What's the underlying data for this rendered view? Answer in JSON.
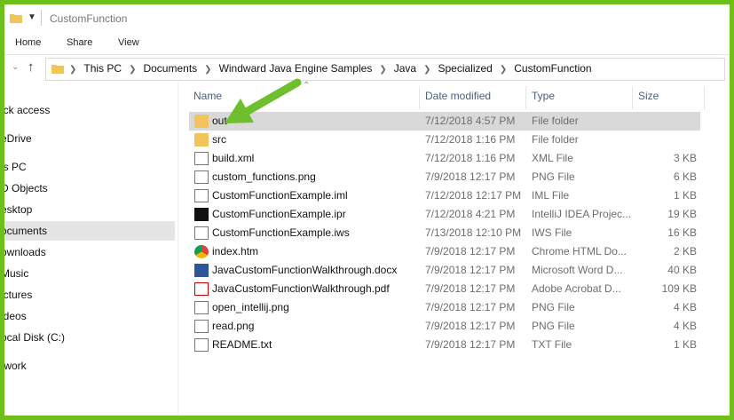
{
  "window": {
    "title": "CustomFunction"
  },
  "ribbon": {
    "tabs": [
      "Home",
      "Share",
      "View"
    ]
  },
  "address": {
    "crumbs": [
      "This PC",
      "Documents",
      "Windward Java Engine Samples",
      "Java",
      "Specialized",
      "CustomFunction"
    ]
  },
  "nav": {
    "items": [
      {
        "label": "ick access"
      },
      {
        "label": "eDrive"
      },
      {
        "label": "is PC"
      },
      {
        "label": "D Objects"
      },
      {
        "label": "esktop"
      },
      {
        "label": "ocuments",
        "selected": true
      },
      {
        "label": "ownloads"
      },
      {
        "label": "Music"
      },
      {
        "label": "ictures"
      },
      {
        "label": "ideos"
      },
      {
        "label": "ocal Disk (C:)"
      },
      {
        "label": "twork"
      }
    ]
  },
  "columns": {
    "name": "Name",
    "date": "Date modified",
    "type": "Type",
    "size": "Size"
  },
  "files": [
    {
      "name": "out",
      "date": "7/12/2018 4:57 PM",
      "type": "File folder",
      "size": "",
      "icon": "folder-icon",
      "selected": true
    },
    {
      "name": "src",
      "date": "7/12/2018 1:16 PM",
      "type": "File folder",
      "size": "",
      "icon": "folder-icon"
    },
    {
      "name": "build.xml",
      "date": "7/12/2018 1:16 PM",
      "type": "XML File",
      "size": "3 KB",
      "icon": "xml-file-icon"
    },
    {
      "name": "custom_functions.png",
      "date": "7/9/2018 12:17 PM",
      "type": "PNG File",
      "size": "6 KB",
      "icon": "png-file-icon"
    },
    {
      "name": "CustomFunctionExample.iml",
      "date": "7/12/2018 12:17 PM",
      "type": "IML File",
      "size": "1 KB",
      "icon": "iml-file-icon"
    },
    {
      "name": "CustomFunctionExample.ipr",
      "date": "7/12/2018 4:21 PM",
      "type": "IntelliJ IDEA Projec...",
      "size": "19 KB",
      "icon": "intellij-icon"
    },
    {
      "name": "CustomFunctionExample.iws",
      "date": "7/13/2018 12:10 PM",
      "type": "IWS File",
      "size": "16 KB",
      "icon": "iws-file-icon"
    },
    {
      "name": "index.htm",
      "date": "7/9/2018 12:17 PM",
      "type": "Chrome HTML Do...",
      "size": "2 KB",
      "icon": "chrome-icon"
    },
    {
      "name": "JavaCustomFunctionWalkthrough.docx",
      "date": "7/9/2018 12:17 PM",
      "type": "Microsoft Word D...",
      "size": "40 KB",
      "icon": "word-icon"
    },
    {
      "name": "JavaCustomFunctionWalkthrough.pdf",
      "date": "7/9/2018 12:17 PM",
      "type": "Adobe Acrobat D...",
      "size": "109 KB",
      "icon": "pdf-icon"
    },
    {
      "name": "open_intellij.png",
      "date": "7/9/2018 12:17 PM",
      "type": "PNG File",
      "size": "4 KB",
      "icon": "png-file-icon"
    },
    {
      "name": "read.png",
      "date": "7/9/2018 12:17 PM",
      "type": "PNG File",
      "size": "4 KB",
      "icon": "png-file-icon"
    },
    {
      "name": "README.txt",
      "date": "7/9/2018 12:17 PM",
      "type": "TXT File",
      "size": "1 KB",
      "icon": "txt-file-icon"
    }
  ],
  "colors": {
    "frame_border": "#6fbf1a",
    "annotation_arrow": "#6dbf2e",
    "selected_row": "#d9d9d9",
    "folder": "#f2c55c"
  }
}
